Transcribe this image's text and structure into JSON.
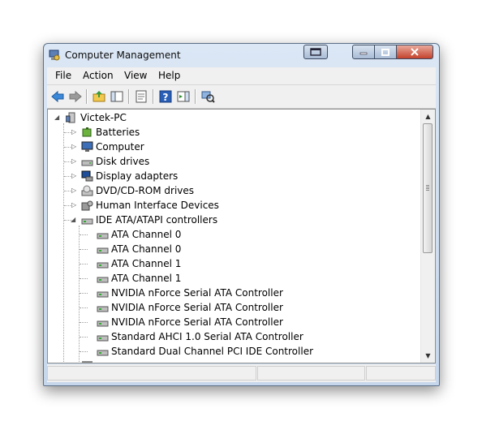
{
  "window": {
    "title": "Computer Management"
  },
  "menu": [
    "File",
    "Action",
    "View",
    "Help"
  ],
  "toolbar": {
    "buttons": [
      "back-arrow-icon",
      "forward-arrow-icon",
      "up-folder-icon",
      "show-hide-tree-icon",
      "properties-icon",
      "help-icon",
      "show-action-pane-icon",
      "scan-hardware-icon"
    ]
  },
  "tree": {
    "root": "Victek-PC",
    "categories": [
      {
        "label": "Batteries",
        "icon": "battery-icon"
      },
      {
        "label": "Computer",
        "icon": "computer-icon"
      },
      {
        "label": "Disk drives",
        "icon": "disk-drive-icon"
      },
      {
        "label": "Display adapters",
        "icon": "display-adapter-icon"
      },
      {
        "label": "DVD/CD-ROM drives",
        "icon": "dvd-drive-icon"
      },
      {
        "label": "Human Interface Devices",
        "icon": "hid-icon"
      }
    ],
    "expanded": {
      "label": "IDE ATA/ATAPI controllers",
      "children": [
        "ATA Channel 0",
        "ATA Channel 0",
        "ATA Channel 1",
        "ATA Channel 1",
        "NVIDIA nForce Serial ATA Controller",
        "NVIDIA nForce Serial ATA Controller",
        "NVIDIA nForce Serial ATA Controller",
        "Standard AHCI 1.0 Serial ATA Controller",
        "Standard Dual Channel PCI IDE Controller"
      ]
    }
  },
  "colors": {
    "titlebar": "#c6d7ec",
    "close": "#c4432c",
    "background": "#f0f0f0"
  }
}
